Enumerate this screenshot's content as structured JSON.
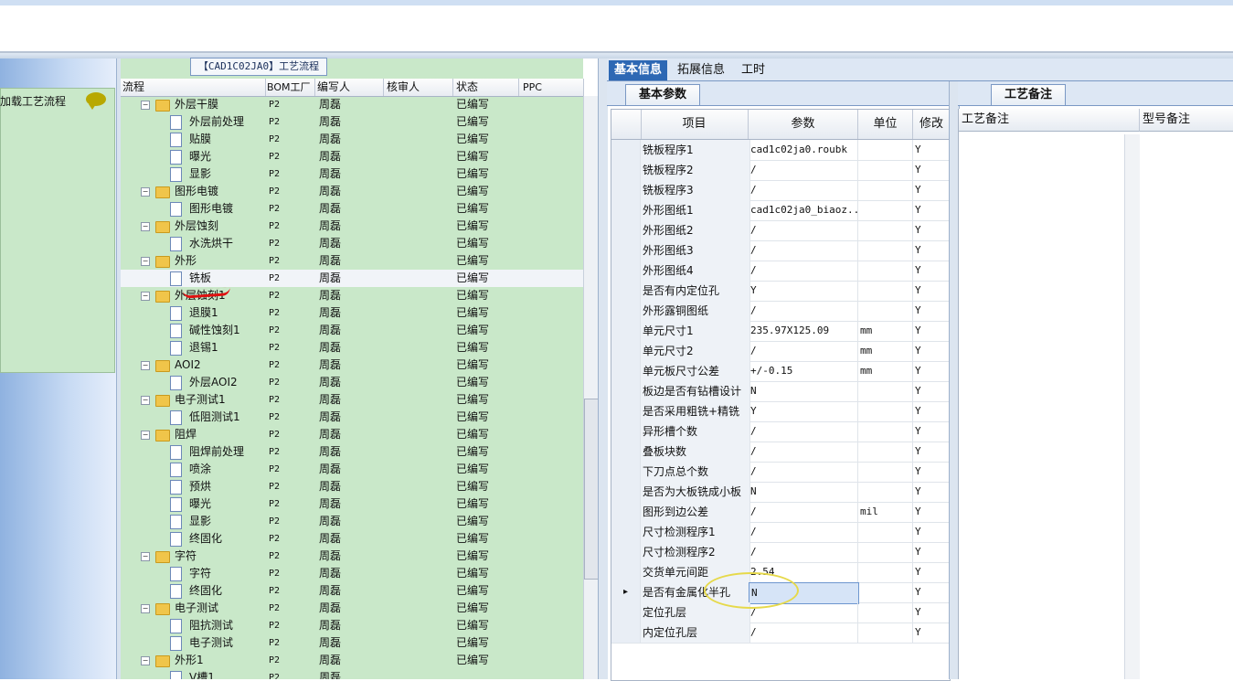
{
  "flow": {
    "tab_title": "【CAD1C02JA0】工艺流程",
    "load_label": "加载工艺流程",
    "columns": [
      "流程",
      "BOM工厂",
      "编写人",
      "核审人",
      "状态",
      "PPC"
    ],
    "rows": [
      {
        "name": "外层干膜",
        "type": "folder",
        "bom": "P2",
        "writer": "周磊",
        "status": "已编写"
      },
      {
        "name": "外层前处理",
        "type": "doc",
        "bom": "P2",
        "writer": "周磊",
        "status": "已编写"
      },
      {
        "name": "贴膜",
        "type": "doc",
        "bom": "P2",
        "writer": "周磊",
        "status": "已编写"
      },
      {
        "name": "曝光",
        "type": "doc",
        "bom": "P2",
        "writer": "周磊",
        "status": "已编写"
      },
      {
        "name": "显影",
        "type": "doc",
        "bom": "P2",
        "writer": "周磊",
        "status": "已编写"
      },
      {
        "name": "图形电镀",
        "type": "folder",
        "bom": "P2",
        "writer": "周磊",
        "status": "已编写"
      },
      {
        "name": "图形电镀",
        "type": "doc",
        "bom": "P2",
        "writer": "周磊",
        "status": "已编写"
      },
      {
        "name": "外层蚀刻",
        "type": "folder",
        "bom": "P2",
        "writer": "周磊",
        "status": "已编写"
      },
      {
        "name": "水洗烘干",
        "type": "doc",
        "bom": "P2",
        "writer": "周磊",
        "status": "已编写"
      },
      {
        "name": "外形",
        "type": "folder",
        "bom": "P2",
        "writer": "周磊",
        "status": "已编写"
      },
      {
        "name": "铣板",
        "type": "doc",
        "bom": "P2",
        "writer": "周磊",
        "status": "已编写",
        "selected": true
      },
      {
        "name": "外层蚀刻1",
        "type": "folder",
        "bom": "P2",
        "writer": "周磊",
        "status": "已编写"
      },
      {
        "name": "退膜1",
        "type": "doc",
        "bom": "P2",
        "writer": "周磊",
        "status": "已编写"
      },
      {
        "name": "碱性蚀刻1",
        "type": "doc",
        "bom": "P2",
        "writer": "周磊",
        "status": "已编写"
      },
      {
        "name": "退锡1",
        "type": "doc",
        "bom": "P2",
        "writer": "周磊",
        "status": "已编写"
      },
      {
        "name": "AOI2",
        "type": "folder",
        "bom": "P2",
        "writer": "周磊",
        "status": "已编写"
      },
      {
        "name": "外层AOI2",
        "type": "doc",
        "bom": "P2",
        "writer": "周磊",
        "status": "已编写"
      },
      {
        "name": "电子测试1",
        "type": "folder",
        "bom": "P2",
        "writer": "周磊",
        "status": "已编写"
      },
      {
        "name": "低阻测试1",
        "type": "doc",
        "bom": "P2",
        "writer": "周磊",
        "status": "已编写"
      },
      {
        "name": "阻焊",
        "type": "folder",
        "bom": "P2",
        "writer": "周磊",
        "status": "已编写"
      },
      {
        "name": "阻焊前处理",
        "type": "doc",
        "bom": "P2",
        "writer": "周磊",
        "status": "已编写"
      },
      {
        "name": "喷涂",
        "type": "doc",
        "bom": "P2",
        "writer": "周磊",
        "status": "已编写"
      },
      {
        "name": "预烘",
        "type": "doc",
        "bom": "P2",
        "writer": "周磊",
        "status": "已编写"
      },
      {
        "name": "曝光",
        "type": "doc",
        "bom": "P2",
        "writer": "周磊",
        "status": "已编写"
      },
      {
        "name": "显影",
        "type": "doc",
        "bom": "P2",
        "writer": "周磊",
        "status": "已编写"
      },
      {
        "name": "终固化",
        "type": "doc",
        "bom": "P2",
        "writer": "周磊",
        "status": "已编写"
      },
      {
        "name": "字符",
        "type": "folder",
        "bom": "P2",
        "writer": "周磊",
        "status": "已编写"
      },
      {
        "name": "字符",
        "type": "doc",
        "bom": "P2",
        "writer": "周磊",
        "status": "已编写"
      },
      {
        "name": "终固化",
        "type": "doc",
        "bom": "P2",
        "writer": "周磊",
        "status": "已编写"
      },
      {
        "name": "电子测试",
        "type": "folder",
        "bom": "P2",
        "writer": "周磊",
        "status": "已编写"
      },
      {
        "name": "阻抗测试",
        "type": "doc",
        "bom": "P2",
        "writer": "周磊",
        "status": "已编写"
      },
      {
        "name": "电子测试",
        "type": "doc",
        "bom": "P2",
        "writer": "周磊",
        "status": "已编写"
      },
      {
        "name": "外形1",
        "type": "folder",
        "bom": "P2",
        "writer": "周磊",
        "status": "已编写"
      },
      {
        "name": "V槽1",
        "type": "doc",
        "bom": "P2",
        "writer": "周磊",
        "status": ""
      }
    ]
  },
  "top_tabs": [
    "基本信息",
    "拓展信息",
    "工时"
  ],
  "params": {
    "sub_tab": "基本参数",
    "columns": [
      "项目",
      "参数",
      "单位",
      "修改"
    ],
    "rows": [
      {
        "item": "铣板程序1",
        "value": "cad1c02ja0.roubk",
        "unit": "",
        "mod": "Y"
      },
      {
        "item": "铣板程序2",
        "value": "/",
        "unit": "",
        "mod": "Y"
      },
      {
        "item": "铣板程序3",
        "value": "/",
        "unit": "",
        "mod": "Y"
      },
      {
        "item": "外形图纸1",
        "value": "cad1c02ja0_biaoz...",
        "unit": "",
        "mod": "Y"
      },
      {
        "item": "外形图纸2",
        "value": "/",
        "unit": "",
        "mod": "Y"
      },
      {
        "item": "外形图纸3",
        "value": "/",
        "unit": "",
        "mod": "Y"
      },
      {
        "item": "外形图纸4",
        "value": "/",
        "unit": "",
        "mod": "Y"
      },
      {
        "item": "是否有内定位孔",
        "value": "Y",
        "unit": "",
        "mod": "Y"
      },
      {
        "item": "外形露铜图纸",
        "value": "/",
        "unit": "",
        "mod": "Y"
      },
      {
        "item": "单元尺寸1",
        "value": "235.97X125.09",
        "unit": "mm",
        "mod": "Y"
      },
      {
        "item": "单元尺寸2",
        "value": "/",
        "unit": "mm",
        "mod": "Y"
      },
      {
        "item": "单元板尺寸公差",
        "value": "+/-0.15",
        "unit": "mm",
        "mod": "Y"
      },
      {
        "item": "板边是否有钻槽设计",
        "value": "N",
        "unit": "",
        "mod": "Y"
      },
      {
        "item": "是否采用粗铣+精铣",
        "value": "Y",
        "unit": "",
        "mod": "Y"
      },
      {
        "item": "异形槽个数",
        "value": "/",
        "unit": "",
        "mod": "Y"
      },
      {
        "item": "叠板块数",
        "value": "/",
        "unit": "",
        "mod": "Y"
      },
      {
        "item": "下刀点总个数",
        "value": "/",
        "unit": "",
        "mod": "Y"
      },
      {
        "item": "是否为大板铣成小板",
        "value": "N",
        "unit": "",
        "mod": "Y"
      },
      {
        "item": "图形到边公差",
        "value": "/",
        "unit": "mil",
        "mod": "Y"
      },
      {
        "item": "尺寸检测程序1",
        "value": "/",
        "unit": "",
        "mod": "Y"
      },
      {
        "item": "尺寸检测程序2",
        "value": "/",
        "unit": "",
        "mod": "Y"
      },
      {
        "item": "交货单元间距",
        "value": "2.54",
        "unit": "",
        "mod": "Y"
      },
      {
        "item": "是否有金属化半孔",
        "value": "N",
        "unit": "",
        "mod": "Y",
        "current": true
      },
      {
        "item": "定位孔层",
        "value": "/",
        "unit": "",
        "mod": "Y"
      },
      {
        "item": "内定位孔层",
        "value": "/",
        "unit": "",
        "mod": "Y"
      }
    ]
  },
  "notes": {
    "tab": "工艺备注",
    "columns": [
      "工艺备注",
      "型号备注"
    ]
  }
}
